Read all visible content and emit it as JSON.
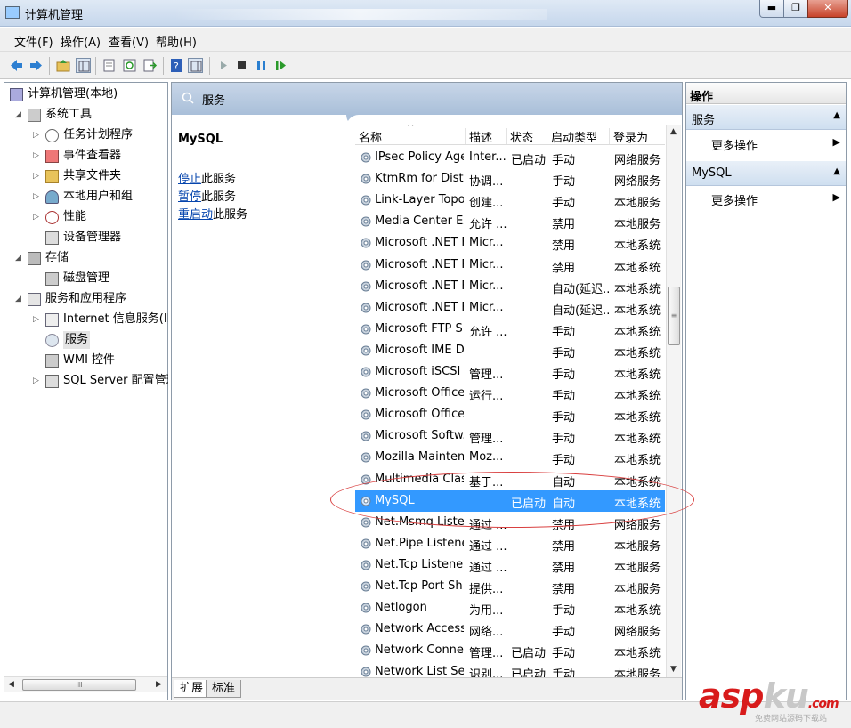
{
  "window": {
    "title": "计算机管理",
    "min": "▬",
    "max": "❐",
    "close": "✕"
  },
  "menu": [
    "文件(F)",
    "操作(A)",
    "查看(V)",
    "帮助(H)"
  ],
  "tree": {
    "root": "计算机管理(本地)",
    "system_tools": "系统工具",
    "task_scheduler": "任务计划程序",
    "event_viewer": "事件查看器",
    "shared_folders": "共享文件夹",
    "local_users": "本地用户和组",
    "performance": "性能",
    "device_manager": "设备管理器",
    "storage": "存储",
    "disk_mgmt": "磁盘管理",
    "services_apps": "服务和应用程序",
    "iis": "Internet 信息服务(IIS)管",
    "services": "服务",
    "wmi": "WMI 控件",
    "sql_server": "SQL Server 配置管理器"
  },
  "hscroll_grip": "III",
  "center": {
    "header": "服务",
    "selected_service": "MySQL",
    "stop_link": "停止",
    "stop_suffix": "此服务",
    "pause_link": "暂停",
    "pause_suffix": "此服务",
    "restart_link": "重启动",
    "restart_suffix": "此服务",
    "columns": {
      "name": "名称",
      "desc": "描述",
      "status": "状态",
      "startup": "启动类型",
      "logon": "登录为"
    },
    "sort_indicator": "^",
    "rows": [
      {
        "name": "IPsec Policy Agent",
        "desc": "Inter...",
        "status": "已启动",
        "startup": "手动",
        "logon": "网络服务"
      },
      {
        "name": "KtmRm for Distri...",
        "desc": "协调...",
        "status": "",
        "startup": "手动",
        "logon": "网络服务"
      },
      {
        "name": "Link-Layer Topol...",
        "desc": "创建...",
        "status": "",
        "startup": "手动",
        "logon": "本地服务"
      },
      {
        "name": "Media Center Ex...",
        "desc": "允许 ...",
        "status": "",
        "startup": "禁用",
        "logon": "本地服务"
      },
      {
        "name": "Microsoft .NET F...",
        "desc": "Micr...",
        "status": "",
        "startup": "禁用",
        "logon": "本地系统"
      },
      {
        "name": "Microsoft .NET F...",
        "desc": "Micr...",
        "status": "",
        "startup": "禁用",
        "logon": "本地系统"
      },
      {
        "name": "Microsoft .NET F...",
        "desc": "Micr...",
        "status": "",
        "startup": "自动(延迟...",
        "logon": "本地系统"
      },
      {
        "name": "Microsoft .NET F...",
        "desc": "Micr...",
        "status": "",
        "startup": "自动(延迟...",
        "logon": "本地系统"
      },
      {
        "name": "Microsoft FTP S...",
        "desc": "允许 ...",
        "status": "",
        "startup": "手动",
        "logon": "本地系统"
      },
      {
        "name": "Microsoft IME D...",
        "desc": "",
        "status": "",
        "startup": "手动",
        "logon": "本地系统"
      },
      {
        "name": "Microsoft iSCSI I...",
        "desc": "管理...",
        "status": "",
        "startup": "手动",
        "logon": "本地系统"
      },
      {
        "name": "Microsoft Office...",
        "desc": "运行...",
        "status": "",
        "startup": "手动",
        "logon": "本地系统"
      },
      {
        "name": "Microsoft Office...",
        "desc": "",
        "status": "",
        "startup": "手动",
        "logon": "本地系统"
      },
      {
        "name": "Microsoft Softw...",
        "desc": "管理...",
        "status": "",
        "startup": "手动",
        "logon": "本地系统"
      },
      {
        "name": "Mozilla Mainten...",
        "desc": "Moz...",
        "status": "",
        "startup": "手动",
        "logon": "本地系统"
      },
      {
        "name": "Multimedia Clas...",
        "desc": "基于...",
        "status": "",
        "startup": "自动",
        "logon": "本地系统"
      },
      {
        "name": "MySQL",
        "desc": "",
        "status": "已启动",
        "startup": "自动",
        "logon": "本地系统",
        "selected": true
      },
      {
        "name": "Net.Msmq Liste...",
        "desc": "通过 ...",
        "status": "",
        "startup": "禁用",
        "logon": "网络服务"
      },
      {
        "name": "Net.Pipe Listene...",
        "desc": "通过 ...",
        "status": "",
        "startup": "禁用",
        "logon": "本地服务"
      },
      {
        "name": "Net.Tcp Listener...",
        "desc": "通过 ...",
        "status": "",
        "startup": "禁用",
        "logon": "本地服务"
      },
      {
        "name": "Net.Tcp Port Sh...",
        "desc": "提供...",
        "status": "",
        "startup": "禁用",
        "logon": "本地服务"
      },
      {
        "name": "Netlogon",
        "desc": "为用...",
        "status": "",
        "startup": "手动",
        "logon": "本地系统"
      },
      {
        "name": "Network Access ...",
        "desc": "网络...",
        "status": "",
        "startup": "手动",
        "logon": "网络服务"
      },
      {
        "name": "Network Connec...",
        "desc": "管理...",
        "status": "已启动",
        "startup": "手动",
        "logon": "本地系统"
      },
      {
        "name": "Network List Ser...",
        "desc": "识别...",
        "status": "已启动",
        "startup": "手动",
        "logon": "本地服务"
      }
    ],
    "tabs": [
      "扩展",
      "标准"
    ],
    "vscroll_grip": "≡"
  },
  "actions": {
    "title": "操作",
    "section1": "服务",
    "section1_more": "更多操作",
    "section2": "MySQL",
    "section2_more": "更多操作",
    "collapse_arrow": "▲",
    "submenu_arrow": "▶"
  },
  "watermark": {
    "asp": "asp",
    "ku": "ku",
    "com": ".com",
    "sub": "免费网站源码下载站"
  },
  "colors": {
    "selected_row": "#3399ff",
    "header_band": "#a9bfd9",
    "link": "#0645ad",
    "annotation": "#d94040"
  }
}
